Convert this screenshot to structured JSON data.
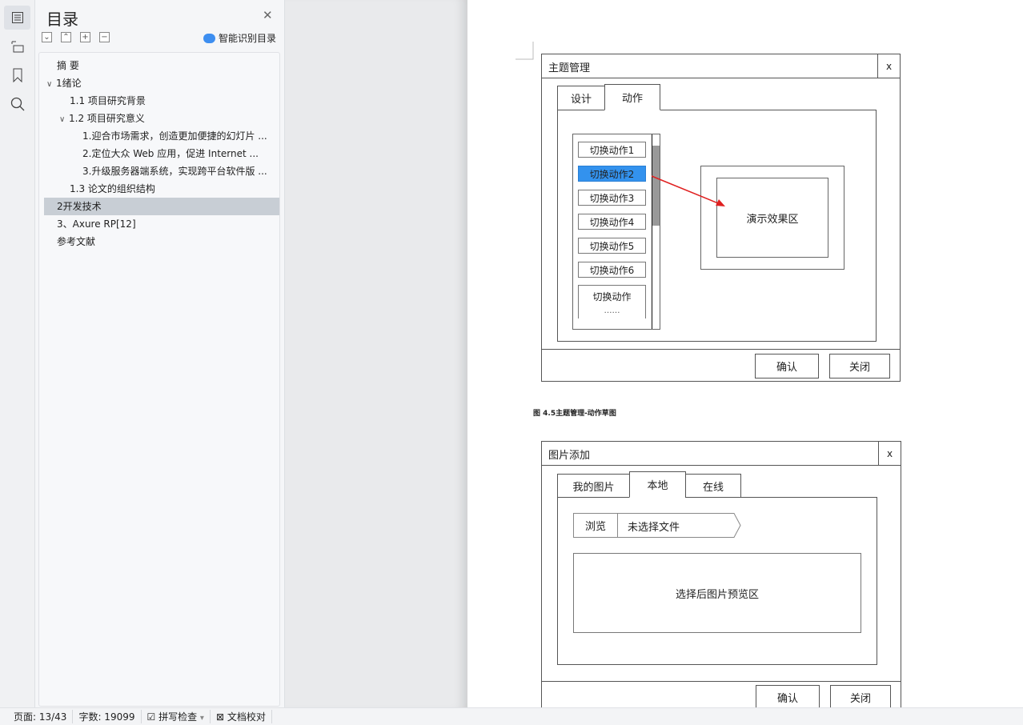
{
  "sidebar": {
    "icons": [
      "toc-icon",
      "outline-icon",
      "bookmark-icon",
      "search-icon"
    ]
  },
  "toc": {
    "title": "目录",
    "smart_label": "智能识别目录",
    "items": [
      {
        "label": "摘 要",
        "level": 0
      },
      {
        "label": "1绪论",
        "level": 0,
        "expanded": true
      },
      {
        "label": "1.1 项目研究背景",
        "level": 1
      },
      {
        "label": "1.2 项目研究意义",
        "level": 1,
        "expanded": true
      },
      {
        "label": "1.迎合市场需求，创造更加便捷的幻灯片 ...",
        "level": 2
      },
      {
        "label": "2.定位大众 Web 应用，促进 Internet ...",
        "level": 2
      },
      {
        "label": "3.升级服务器端系统，实现跨平台软件版 ...",
        "level": 2
      },
      {
        "label": "1.3 论文的组织结构",
        "level": 1
      },
      {
        "label": "2开发技术",
        "level": 0,
        "selected": true
      },
      {
        "label": "3、Axure RP[12]",
        "level": 0
      },
      {
        "label": "参考文献",
        "level": 0
      }
    ]
  },
  "dialog1": {
    "title": "主题管理",
    "close": "x",
    "tabs": [
      "设计",
      "动作"
    ],
    "active_tab": "动作",
    "items": [
      "切换动作1",
      "切换动作2",
      "切换动作3",
      "切换动作4",
      "切换动作5",
      "切换动作6"
    ],
    "last_item": "切换动作",
    "last_item_more": "……",
    "selected_item": "切换动作2",
    "preview": "演示效果区",
    "confirm": "确认",
    "cancel": "关闭"
  },
  "caption": "图 4.5主题管理-动作草图",
  "dialog2": {
    "title": "图片添加",
    "close": "x",
    "tabs": [
      "我的图片",
      "本地",
      "在线"
    ],
    "active_tab": "本地",
    "browse": "浏览",
    "file_text": "未选择文件",
    "preview": "选择后图片预览区",
    "confirm": "确认",
    "cancel": "关闭"
  },
  "status": {
    "page": "页面: 13/43",
    "words": "字数: 19099",
    "spell": "拼写检查",
    "proof": "文档校对"
  },
  "colors": {
    "accent": "#3392ee",
    "arrow": "#e02020",
    "selected_row": "#c8ced5"
  }
}
